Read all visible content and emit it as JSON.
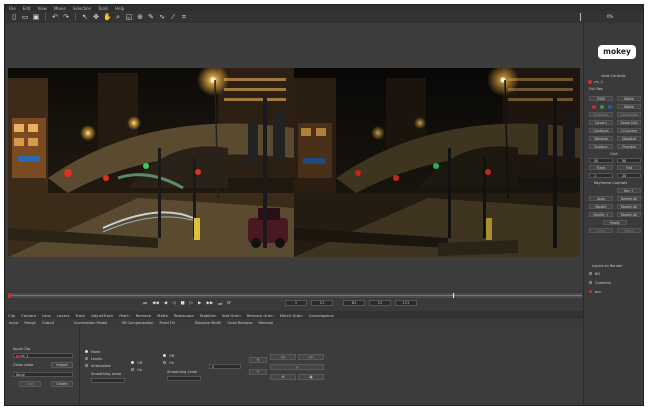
{
  "menu": [
    "File",
    "Edit",
    "View",
    "Movie",
    "Selection",
    "Tools",
    "Help"
  ],
  "toolbar_icons": [
    "new-file-icon",
    "open-folder-icon",
    "save-icon",
    "undo-icon",
    "redo-icon",
    "pointer-icon",
    "transform-icon",
    "hand-icon",
    "zoom-icon",
    "shape-icon",
    "add-point-icon",
    "brush-icon",
    "spline-icon",
    "magic-wand-icon",
    "crop-icon"
  ],
  "top_right": {
    "readout": "0%"
  },
  "right_panel": {
    "logo": "mokey",
    "view_controls_title": "View Controls",
    "layer_label": "clc_1",
    "fullres": "Full Res",
    "rgb": "RGB",
    "matte": "Matte",
    "overlays": "Overlays",
    "compose": "Composite",
    "layers": "Layers",
    "zoom_info": "Zoom Info",
    "contours": "Contours",
    "ui_layers": "UI Layers",
    "weights": "Weights",
    "stabilize": "Stabilize",
    "surface": "Surface",
    "preview": "Preview",
    "grid": "Grid",
    "track": "Track",
    "flat": "Flat",
    "val_left": "50",
    "val_right": "50",
    "val_small": "1",
    "val_small2": "20",
    "keyframe_title": "Keyframe Controls",
    "key": "Key +",
    "auto": "Auto",
    "delete_all": "Delete All",
    "modify": "Modify",
    "modify_all": "Modify All",
    "modify2": "Modify +",
    "modify_all2": "Modify All",
    "reset": "Reset",
    "copy": "Copy",
    "paste": "Paste",
    "layers_to_render": "Layers to Render",
    "bg": "BG",
    "combine": "Combine",
    "ren": "bcc"
  },
  "timeline": {
    "transport": [
      "⏮",
      "◀◀",
      "◀",
      "◁",
      "■",
      "▷",
      "▶",
      "▶▶",
      "⏭",
      "⟳"
    ],
    "frames": [
      "1",
      "21",
      "81",
      "21",
      "111"
    ]
  },
  "tabs": [
    "Clip",
    "Camera",
    "Lens",
    "Layers",
    "Track",
    "AdjustTrack",
    "Patch",
    "Remove",
    "Matte",
    "Rotoscope",
    "Stabilize",
    "Add Grain",
    "Remove Grain",
    "Match Grain",
    "Convergence"
  ],
  "subtabs": [
    "Input",
    "Range",
    "Output",
    "Illumination Model",
    "3D Compensation",
    "Fixed Fill",
    "Dissolve Width",
    "Undo Remove",
    "Remove"
  ],
  "params": {
    "input_clip": "Input Clip",
    "clip_name": "clc_1",
    "clean_plate": "Clean plate",
    "import": "Import",
    "none": "None",
    "copy": "Copy",
    "create": "Create",
    "radio_none": "None",
    "radio_linear": "Linear",
    "radio_interpolate": "Interpolate",
    "smoothing": "Smoothing Level",
    "off": "Off",
    "on": "On",
    "off2": "Off",
    "on2": "On",
    "smoothing2": "Smoothing Level",
    "num": "0"
  }
}
